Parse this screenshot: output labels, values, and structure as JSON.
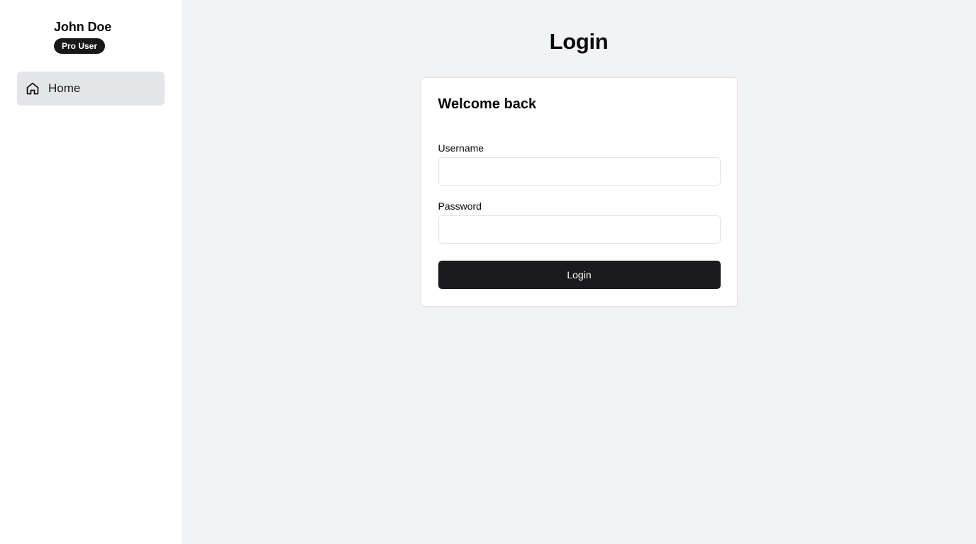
{
  "sidebar": {
    "user_name": "John Doe",
    "badge": "Pro User",
    "nav_items": [
      {
        "label": "Home",
        "icon": "home-icon",
        "active": true
      }
    ]
  },
  "main": {
    "title": "Login",
    "card": {
      "title": "Welcome back",
      "username_label": "Username",
      "username_value": "",
      "username_placeholder": "",
      "password_label": "Password",
      "password_value": "",
      "password_placeholder": "",
      "submit_label": "Login"
    }
  },
  "colors": {
    "sidebar_bg": "#ffffff",
    "main_bg": "#f2f3f5",
    "nav_active_bg": "#e4e5e8",
    "button_bg": "#1b1b1d",
    "badge_bg": "#18181b"
  }
}
